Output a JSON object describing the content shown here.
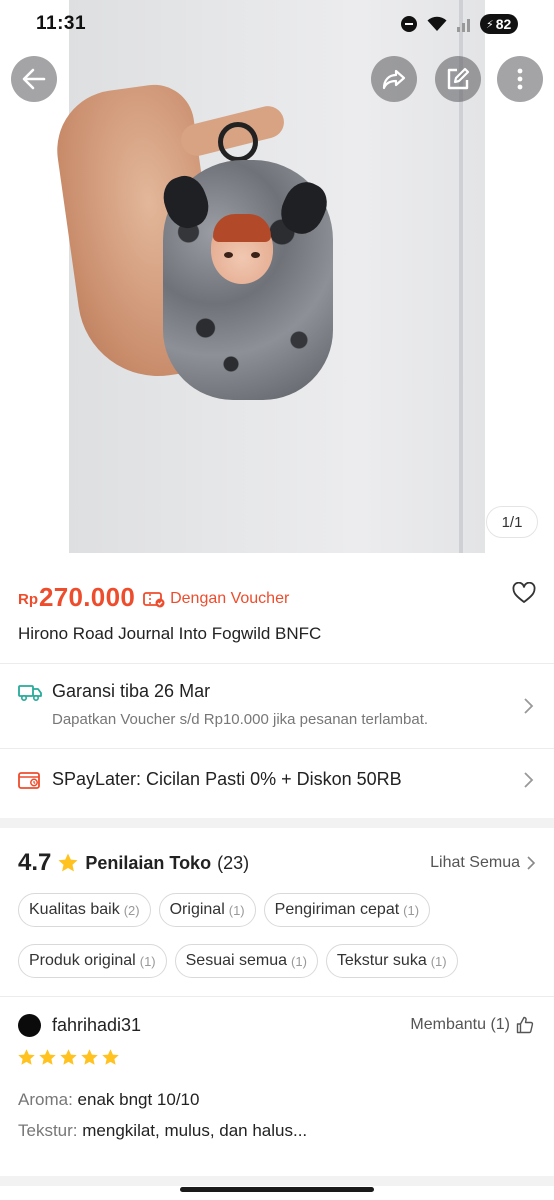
{
  "status_bar": {
    "time": "11:31",
    "battery": "82"
  },
  "photo": {
    "counter": "1/1"
  },
  "price": {
    "currency": "Rp",
    "value": "270.000",
    "voucher_label": "Dengan Voucher",
    "accent": "#ee4d2d"
  },
  "product": {
    "title": "Hirono Road Journal Into Fogwild BNFC"
  },
  "shipping": {
    "title": "Garansi tiba 26 Mar",
    "subtitle": "Dapatkan Voucher s/d Rp10.000 jika pesanan terlambat."
  },
  "paylater": {
    "title": "SPayLater: Cicilan Pasti 0% + Diskon 50RB"
  },
  "rating": {
    "score": "4.7",
    "label": "Penilaian Toko",
    "count": "(23)",
    "see_all": "Lihat Semua",
    "chips": [
      {
        "label": "Kualitas baik",
        "count": "(2)"
      },
      {
        "label": "Original",
        "count": "(1)"
      },
      {
        "label": "Pengiriman cepat",
        "count": "(1)"
      },
      {
        "label": "Produk original",
        "count": "(1)"
      },
      {
        "label": "Sesuai semua",
        "count": "(1)"
      },
      {
        "label": "Tekstur suka",
        "count": "(1)"
      }
    ]
  },
  "review": {
    "user": "fahrihadi31",
    "helpful": "Membantu (1)",
    "stars": 5,
    "lines": [
      {
        "key": "Aroma:",
        "value": "enak bngt 10/10"
      },
      {
        "key": "Tekstur:",
        "value": "mengkilat, mulus, dan halus..."
      }
    ]
  },
  "colors": {
    "star": "#ffc21f",
    "accent": "#ee4d2d",
    "shipping_icon": "#26aa99"
  }
}
